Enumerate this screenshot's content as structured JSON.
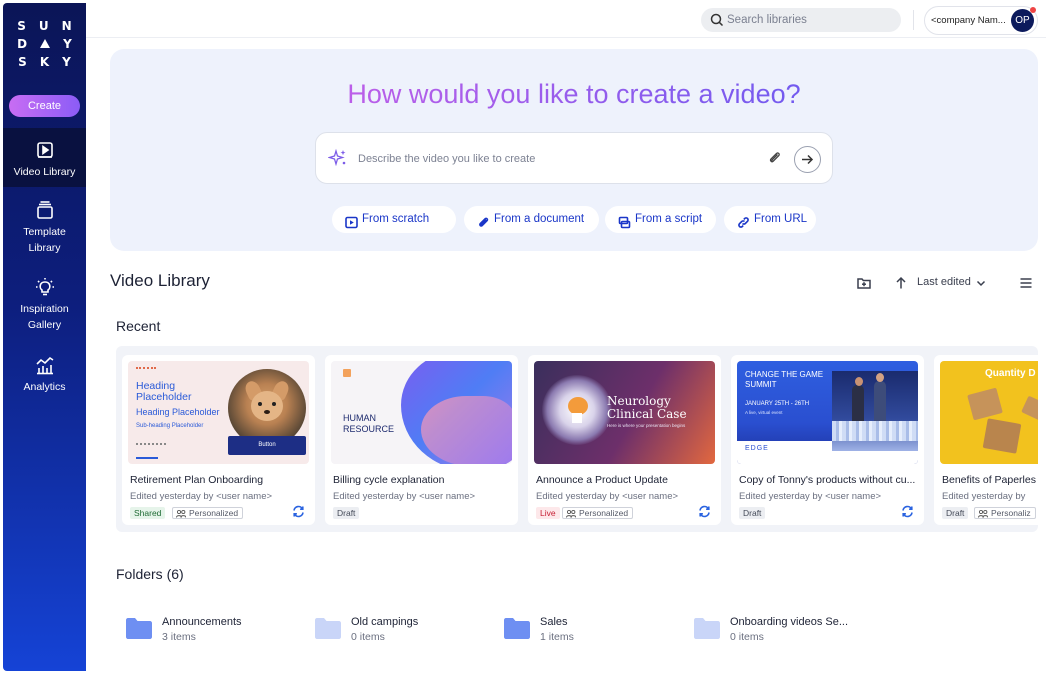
{
  "brand": {
    "logo_rows": [
      "SUN",
      "DAY",
      "SKY"
    ]
  },
  "sidebar": {
    "create_label": "Create",
    "items": [
      {
        "label1": "Video Library",
        "label2": "",
        "icon": "play-square-icon"
      },
      {
        "label1": "Template",
        "label2": "Library",
        "icon": "stack-icon"
      },
      {
        "label1": "Inspiration",
        "label2": "Gallery",
        "icon": "lightbulb-icon"
      },
      {
        "label1": "Analytics",
        "label2": "",
        "icon": "chart-icon"
      }
    ]
  },
  "topbar": {
    "search_placeholder": "Search libraries",
    "company": "<company Nam...",
    "avatar_initials": "OP"
  },
  "hero": {
    "heading": "How would you like to create a video?",
    "prompt_placeholder": "Describe the video you like to create",
    "options": [
      "From scratch",
      "From a document",
      "From a script",
      "From URL"
    ]
  },
  "library": {
    "title": "Video Library",
    "sort_label": "Last edited",
    "recent_title": "Recent",
    "cards": [
      {
        "title": "Retirement Plan Onboarding",
        "edited": "Edited yesterday by <user name>",
        "status": "Shared",
        "personalized": "Personalized",
        "synced": true,
        "thumb": {
          "h1": "Heading",
          "h2": "Placeholder",
          "sub": "Heading Placeholder",
          "subsub": "Sub-heading Placeholder",
          "button": "Button"
        }
      },
      {
        "title": "Billing cycle explanation",
        "edited": "Edited yesterday by <user name>",
        "status": "Draft",
        "personalized": "",
        "synced": false,
        "thumb": {
          "line1": "HUMAN",
          "line2": "RESOURCE"
        }
      },
      {
        "title": "Announce a Product Update",
        "edited": "Edited yesterday by <user name>",
        "status": "Live",
        "personalized": "Personalized",
        "synced": true,
        "thumb": {
          "line1": "Neurology",
          "line2": "Clinical Case",
          "sub": "Here is where your presentation begins"
        }
      },
      {
        "title": "Copy of Tonny's products without cu...",
        "edited": "Edited yesterday by <user name>",
        "status": "Draft",
        "personalized": "",
        "synced": true,
        "thumb": {
          "line1": "CHANGE THE GAME",
          "line2": "SUMMIT",
          "date": "JANUARY 25TH - 26TH",
          "sub": "A live, virtual event",
          "logo": "EDGE"
        }
      },
      {
        "title": "Benefits of Paperles",
        "edited": "Edited yesterday by",
        "status": "Draft",
        "personalized": "Personaliz",
        "synced": false,
        "thumb": {
          "line1": "Quantity D"
        }
      }
    ]
  },
  "folders": {
    "title": "Folders (6)",
    "items": [
      {
        "name": "Announcements",
        "count": "3 items",
        "color": "#6e8ff2"
      },
      {
        "name": "Old campings",
        "count": "0 items",
        "color": "#c9d5f8"
      },
      {
        "name": "Sales",
        "count": "1 items",
        "color": "#6e8ff2"
      },
      {
        "name": "Onboarding videos Se...",
        "count": "0 items",
        "color": "#c9d5f8"
      }
    ]
  },
  "colors": {
    "accent": "#1a36c8",
    "sidebar_top": "#0b1557",
    "sidebar_bottom": "#1543d6",
    "hero_bg": "#eef2fc"
  }
}
